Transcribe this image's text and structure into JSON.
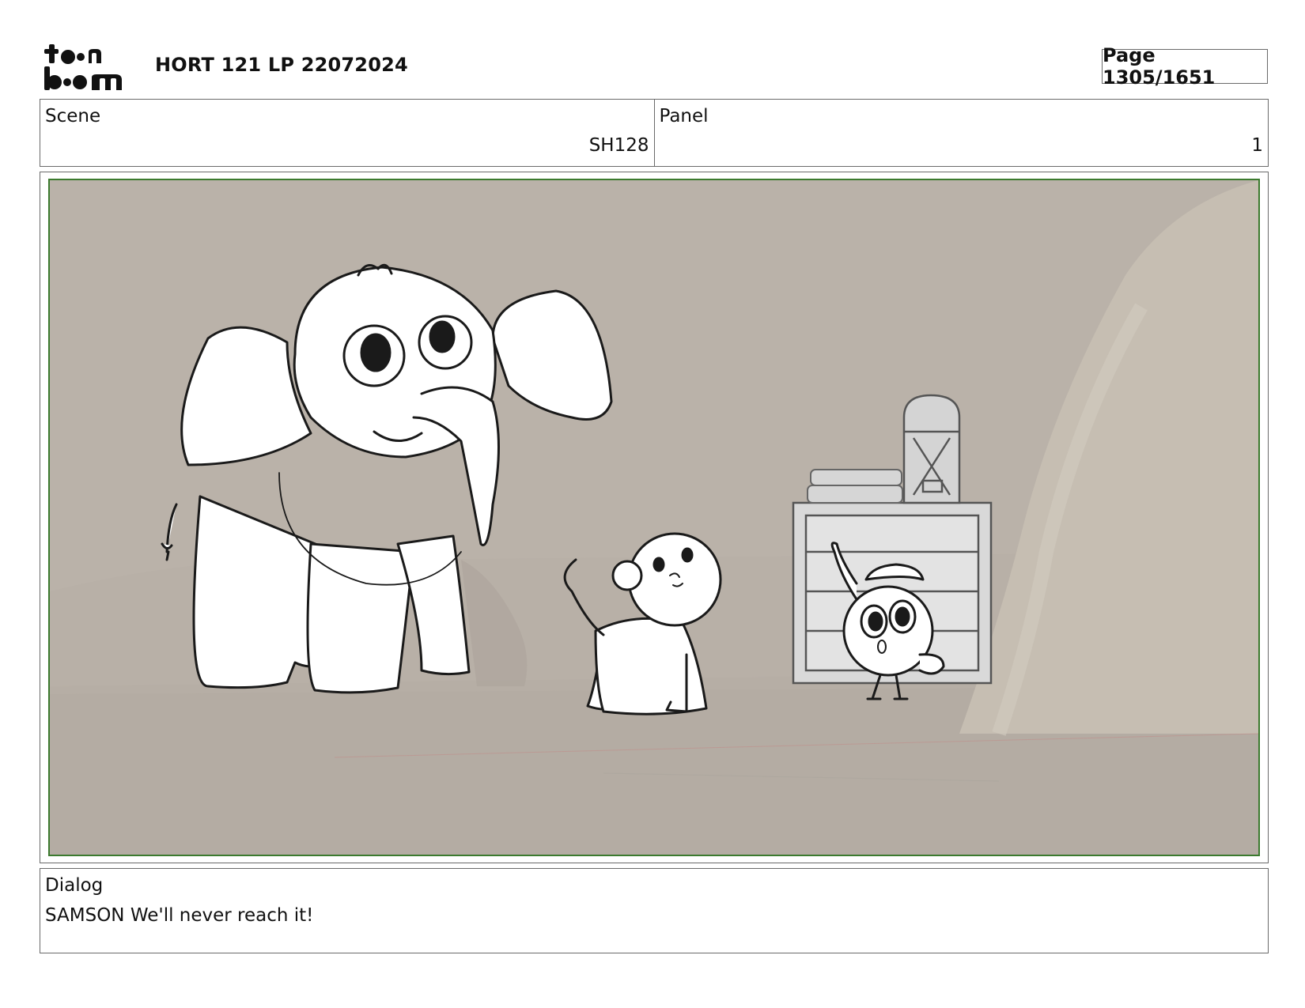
{
  "header": {
    "logo_text_top": "toon",
    "logo_text_bottom": "boom",
    "project_title": "HORT 121 LP 22072024",
    "page_label": "Page 1305/1651"
  },
  "scene": {
    "label": "Scene",
    "value": "SH128"
  },
  "panel": {
    "label": "Panel",
    "value": "1"
  },
  "dialog": {
    "label": "Dialog",
    "text": "SAMSON We'll never reach it!"
  },
  "colors": {
    "background_tone": "#bbb3aa",
    "safe_frame": "#3b7a2e",
    "line_art": "#1a1a1a"
  }
}
